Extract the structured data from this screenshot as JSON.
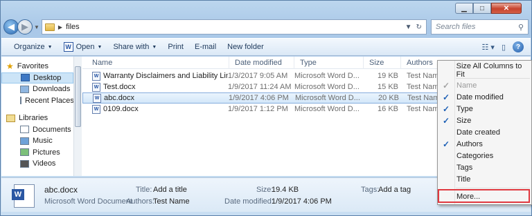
{
  "window": {
    "min_glyph": "▁",
    "max_glyph": "□",
    "close_glyph": "✕"
  },
  "address": {
    "back_glyph": "◀",
    "fwd_glyph": "▶",
    "crumb_sep": "▶",
    "path": "files",
    "refresh_glyph": "↻",
    "search_placeholder": "Search files"
  },
  "toolbar": {
    "organize": "Organize",
    "open": "Open",
    "share_with": "Share with",
    "print": "Print",
    "email": "E-mail",
    "new_folder": "New folder",
    "word_icon": "W"
  },
  "nav": {
    "favorites": "Favorites",
    "desktop": "Desktop",
    "downloads": "Downloads",
    "recent_places": "Recent Places",
    "libraries": "Libraries",
    "documents": "Documents",
    "music": "Music",
    "pictures": "Pictures",
    "videos": "Videos"
  },
  "columns": {
    "name": "Name",
    "date_modified": "Date modified",
    "type": "Type",
    "size": "Size",
    "authors": "Authors"
  },
  "files": [
    {
      "name": "Warranty Disclaimers and Liability Limita...",
      "date": "1/3/2017 9:05 AM",
      "type": "Microsoft Word D...",
      "size": "19 KB",
      "author": "Test Name"
    },
    {
      "name": "Test.docx",
      "date": "1/9/2017 11:24 AM",
      "type": "Microsoft Word D...",
      "size": "15 KB",
      "author": "Test Name"
    },
    {
      "name": "abc.docx",
      "date": "1/9/2017 4:06 PM",
      "type": "Microsoft Word D...",
      "size": "20 KB",
      "author": "Test Name",
      "selected": true
    },
    {
      "name": "0109.docx",
      "date": "1/9/2017 1:12 PM",
      "type": "Microsoft Word D...",
      "size": "16 KB",
      "author": "Test Name"
    }
  ],
  "details": {
    "filename": "abc.docx",
    "filetype": "Microsoft Word Document",
    "title_label": "Title:",
    "title_value": "Add a title",
    "authors_label": "Authors:",
    "authors_value": "Test Name",
    "size_label": "Size:",
    "size_value": "19.4 KB",
    "date_label": "Date modified:",
    "date_value": "1/9/2017 4:06 PM",
    "tags_label": "Tags:",
    "tags_value": "Add a tag"
  },
  "context_menu": {
    "size_all": "Size All Columns to Fit",
    "items": [
      {
        "label": "Name",
        "checked": true,
        "disabled": true
      },
      {
        "label": "Date modified",
        "checked": true
      },
      {
        "label": "Type",
        "checked": true
      },
      {
        "label": "Size",
        "checked": true
      },
      {
        "label": "Date created",
        "checked": false
      },
      {
        "label": "Authors",
        "checked": true
      },
      {
        "label": "Categories",
        "checked": false
      },
      {
        "label": "Tags",
        "checked": false
      },
      {
        "label": "Title",
        "checked": false
      }
    ],
    "more": "More...",
    "check_glyph": "✓"
  },
  "colors": {
    "highlight_box": "#e0383f",
    "selection": "#d3e7f9",
    "check": "#1c5fb5"
  }
}
